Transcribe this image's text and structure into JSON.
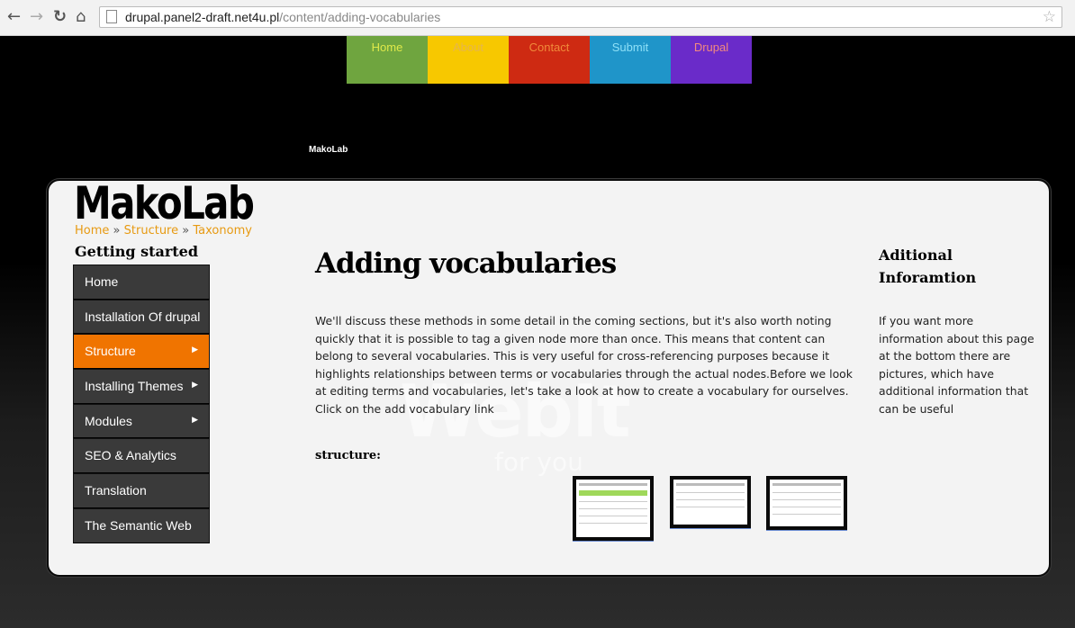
{
  "browser": {
    "url_domain": "drupal.panel2-draft.net4u.pl",
    "url_path": "/content/adding-vocabularies"
  },
  "top_menu": [
    {
      "label": "Home",
      "color": "#6fa53f"
    },
    {
      "label": "About",
      "color": "#f7c800"
    },
    {
      "label": "Contact",
      "color": "#ce2a12"
    },
    {
      "label": "Submit",
      "color": "#1f95c9"
    },
    {
      "label": "Drupal",
      "color": "#6a2bc9"
    }
  ],
  "site_name": "MakoLab",
  "logo_text": "MakoLab",
  "breadcrumb": [
    "Home",
    "Structure",
    "Taxonomy"
  ],
  "breadcrumb_separator": "»",
  "sidebar": {
    "title": "Getting started",
    "items": [
      {
        "label": "Home",
        "has_submenu": false,
        "active": false
      },
      {
        "label": "Installation Of drupal",
        "has_submenu": false,
        "active": false
      },
      {
        "label": "Structure",
        "has_submenu": true,
        "active": true
      },
      {
        "label": "Installing Themes",
        "has_submenu": true,
        "active": false
      },
      {
        "label": "Modules",
        "has_submenu": true,
        "active": false
      },
      {
        "label": "SEO & Analytics",
        "has_submenu": false,
        "active": false
      },
      {
        "label": "Translation",
        "has_submenu": false,
        "active": false
      },
      {
        "label": "The Semantic Web",
        "has_submenu": false,
        "active": false
      }
    ]
  },
  "content": {
    "title": "Adding vocabularies",
    "body": "We'll discuss these methods in some detail in the coming sections, but it's also worth noting quickly that it is possible to tag a given node more than once. This means that content can belong to several vocabularies. This is very useful for cross-referencing purposes because it highlights relationships between terms or vocabularies through the actual nodes.Before we look at editing terms and vocabularies, let's take a look at how to create a vocabulary for ourselves. Click on the add vocabulary link",
    "structure_label": "structure:",
    "watermark": "WebIt",
    "watermark_sub": "for you"
  },
  "aside": {
    "title": "Aditional Inforamtion",
    "body": "If you want more information about this page at the bottom there are pictures, which have additional information that can be useful"
  },
  "icons": {
    "back": "arrow-left-icon",
    "forward": "arrow-right-icon",
    "reload": "reload-icon",
    "home": "home-icon",
    "page": "page-icon",
    "bookmark": "star-icon",
    "submenu": "triangle-right-icon"
  },
  "accent_color": "#f07400"
}
